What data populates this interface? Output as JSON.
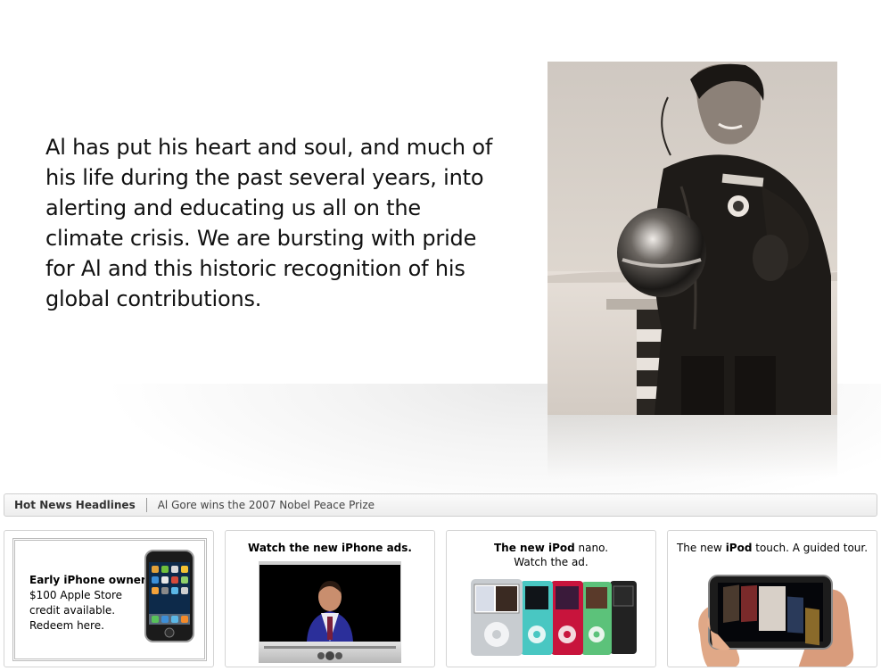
{
  "hero": {
    "quote": "Al has put his heart and soul, and much of his life during the past several years, into alerting and educating us all on the climate crisis. We are bursting with pride for Al and this historic recognition of his global contributions."
  },
  "news": {
    "label": "Hot News Headlines",
    "headline": "Al Gore wins the 2007 Nobel Peace Prize"
  },
  "promos": [
    {
      "lines": [
        "Early iPhone owners:",
        "$100 Apple Store",
        "credit available.",
        "Redeem here."
      ]
    },
    {
      "title": "Watch the new iPhone ads."
    },
    {
      "title_bold": "The new iPod",
      "title_rest": " nano.",
      "title_line2": "Watch the ad."
    },
    {
      "title_pre": "The new ",
      "title_bold": "iPod",
      "title_rest": " touch. A guided tour."
    }
  ],
  "colors": {
    "bar_border": "#cfcfcf",
    "card_border": "#d4d4d4",
    "nano_silver": "#c8ccd0",
    "nano_teal": "#49c7c2",
    "nano_red": "#c8143c",
    "nano_green": "#5cc27a",
    "nano_black": "#222222"
  }
}
